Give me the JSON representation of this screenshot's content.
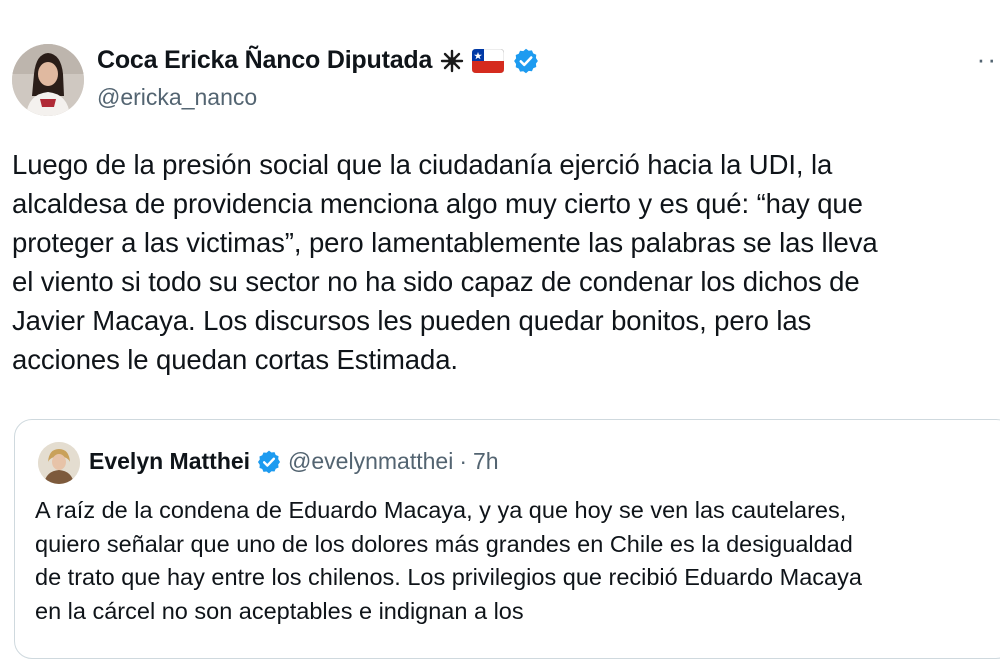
{
  "tweet": {
    "author": {
      "display_name": "Coca Ericka Ñanco Diputada",
      "handle": "@ericka_nanco",
      "badges": [
        "sparkle-emoji",
        "chile-flag-emoji",
        "verified-badge"
      ]
    },
    "more_label": "··",
    "text": "Luego de la presión social que la ciudadanía ejerció hacia la UDI, la\nalcaldesa de providencia menciona algo muy cierto y es qué: “hay que\nproteger a las victimas”, pero lamentablemente las palabras se las lleva\nel viento si todo su sector no ha sido capaz de condenar los dichos de\nJavier Macaya. Los discursos les pueden quedar bonitos, pero las\nacciones le quedan cortas Estimada."
  },
  "quote": {
    "author": {
      "display_name": "Evelyn Matthei",
      "handle": "@evelynmatthei",
      "separator": "·",
      "time": "7h"
    },
    "text": "A raíz de la condena de Eduardo Macaya, y ya que hoy se ven las cautelares,\nquiero señalar que uno de los dolores más grandes en Chile es la desigualdad\nde trato que hay entre los chilenos. Los privilegios que recibió Eduardo Macaya\nen la cárcel no son aceptables e indignan a los"
  },
  "colors": {
    "text": "#0f1419",
    "secondary": "#536471",
    "verified": "#1d9bf0",
    "border": "#cfd9de"
  }
}
